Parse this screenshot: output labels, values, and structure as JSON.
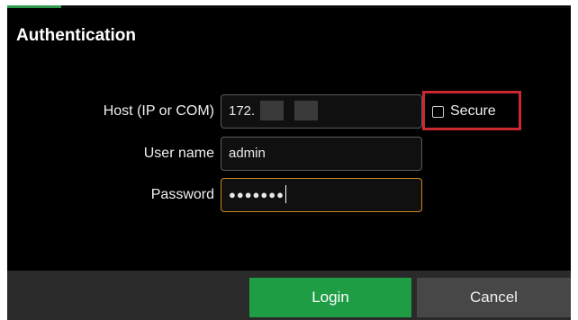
{
  "colors": {
    "accent": "#2f9a4e",
    "login_button": "#1f9d45",
    "highlight": "#c8282e",
    "focus_border": "#c88a1e"
  },
  "dialog": {
    "title": "Authentication"
  },
  "form": {
    "host": {
      "label": "Host (IP or COM)",
      "value_visible": "172."
    },
    "secure": {
      "label": "Secure",
      "checked": false
    },
    "username": {
      "label": "User name",
      "value": "admin"
    },
    "password": {
      "label": "Password",
      "masked_value": "●●●●●●●"
    }
  },
  "buttons": {
    "login_label": "Login",
    "cancel_label": "Cancel"
  }
}
